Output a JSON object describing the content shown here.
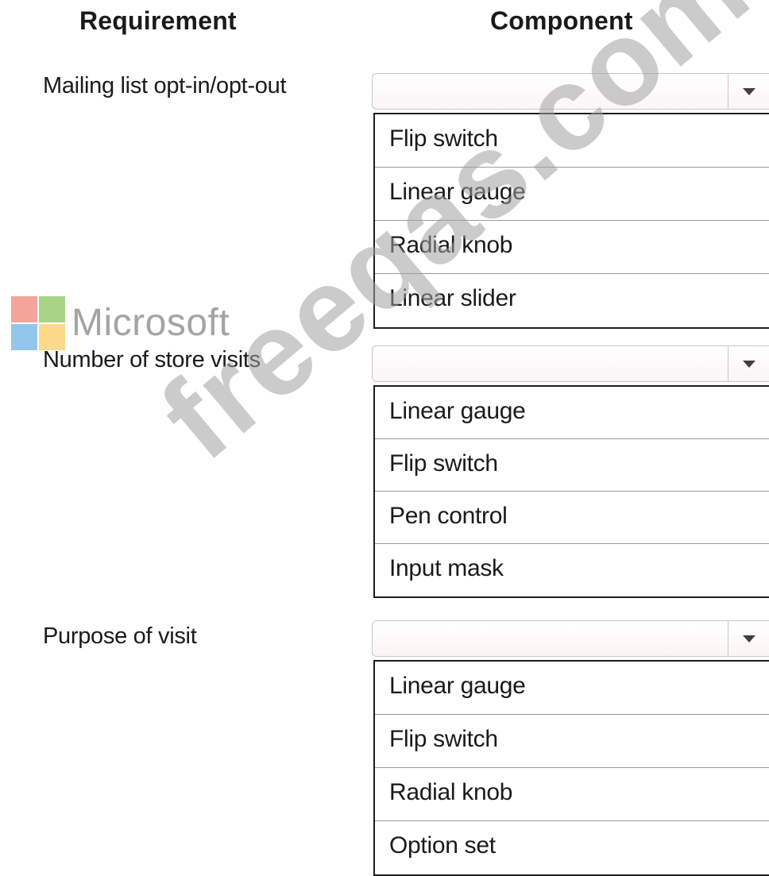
{
  "headers": {
    "requirement": "Requirement",
    "component": "Component"
  },
  "rows": [
    {
      "requirement": "Mailing list opt-in/opt-out",
      "selected": "",
      "options": [
        "Flip switch",
        "Linear gauge",
        "Radial knob",
        "Linear slider"
      ]
    },
    {
      "requirement": "Number of store visits",
      "selected": "",
      "options": [
        "Linear gauge",
        "Flip switch",
        "Pen control",
        "Input mask"
      ]
    },
    {
      "requirement": "Purpose of visit",
      "selected": "",
      "options": [
        "Linear gauge",
        "Flip switch",
        "Radial knob",
        "Option set"
      ]
    }
  ],
  "logo": {
    "text": "Microsoft",
    "colors": [
      "#f3a59a",
      "#a9d486",
      "#93c6ea",
      "#fcd98a"
    ]
  },
  "watermark": {
    "text": "freeqas.com"
  }
}
